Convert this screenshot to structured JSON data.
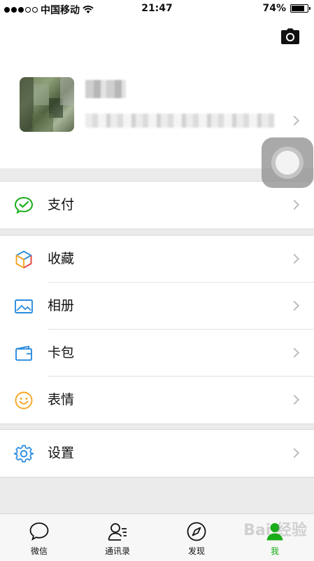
{
  "status_bar": {
    "carrier": "中国移动",
    "time": "21:47",
    "battery_percent": "74%",
    "battery_level": 0.74,
    "signal_filled": 3,
    "signal_total": 5
  },
  "profile": {
    "camera_icon": "camera-icon",
    "avatar_icon": "avatar"
  },
  "menu": {
    "pay": {
      "label": "支付",
      "icon": "wechat-pay-icon",
      "color": "#1aad19"
    },
    "favorites": {
      "label": "收藏",
      "icon": "cube-icon"
    },
    "album": {
      "label": "相册",
      "icon": "picture-icon",
      "color": "#2a8cde"
    },
    "cards": {
      "label": "卡包",
      "icon": "wallet-icon",
      "color": "#2a8cde"
    },
    "stickers": {
      "label": "表情",
      "icon": "smiley-icon",
      "color": "#f5a623"
    },
    "settings": {
      "label": "设置",
      "icon": "gear-icon",
      "color": "#2a8cde"
    }
  },
  "tabbar": {
    "chats": "微信",
    "contacts": "通讯录",
    "discover": "发现",
    "me": "我",
    "active_color": "#1aad19"
  },
  "watermark": "Bai 经验"
}
